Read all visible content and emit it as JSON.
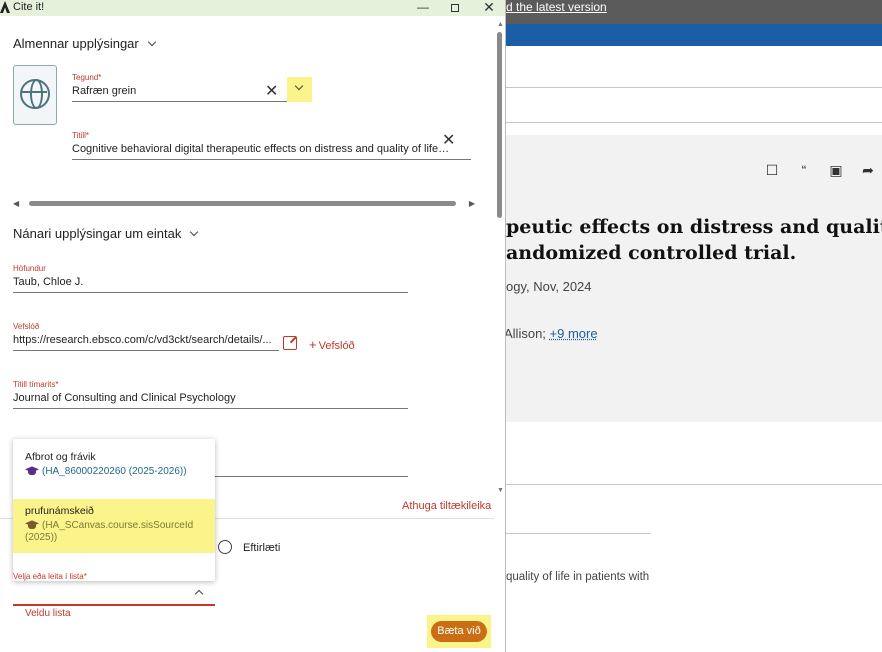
{
  "window": {
    "title": "Cite it!"
  },
  "sections": {
    "general": "Almennar upplýsingar",
    "details": "Nánari upplýsingar um eintak"
  },
  "fields": {
    "type": {
      "label": "Tegund*",
      "value": "Rafræn grein"
    },
    "title": {
      "label": "Titill*",
      "value": "Cognitive behavioral digital therapeutic effects on distress and quality of life in patients with..."
    },
    "author": {
      "label": "Höfundur",
      "value": "Taub, Chloe J."
    },
    "url": {
      "label": "Vefslóð",
      "value": "https://research.ebsco.com/c/vd3ckt/search/details/..."
    },
    "journal": {
      "label": "Titill tímarits*",
      "value": "Journal of Consulting and Clinical Psychology"
    }
  },
  "add_url_label": "Vefslóð",
  "check_tips": "Athuga tiltækileika",
  "radio_label": "Eftirlæti",
  "dropdown": {
    "options": [
      {
        "name": "Afbrot og frávik",
        "code": "(HA_86000220260 (2025-2026))"
      },
      {
        "name": "prufunámskeið",
        "code": "(HA_SCanvas.course.sisSourceId (2025))"
      }
    ]
  },
  "select": {
    "label": "Velja eða leita í lista*",
    "error": "Veldu lista"
  },
  "add_button": "Bæta við",
  "background": {
    "top_link": "d the latest version",
    "title_line1": "peutic effects on distress and quality of lif",
    "title_line2": "andomized controlled trial.",
    "meta": "ogy, Nov, 2024",
    "authors": "Allison; ",
    "more": "+9 more",
    "snippet": "quality of life in patients with"
  },
  "colors": {
    "accent_red": "#c0392b",
    "highlight": "#fbf48a",
    "button_orange": "#c96e14",
    "titlebar": "#e6f1dc",
    "blue_bar": "#1b5ea6"
  }
}
